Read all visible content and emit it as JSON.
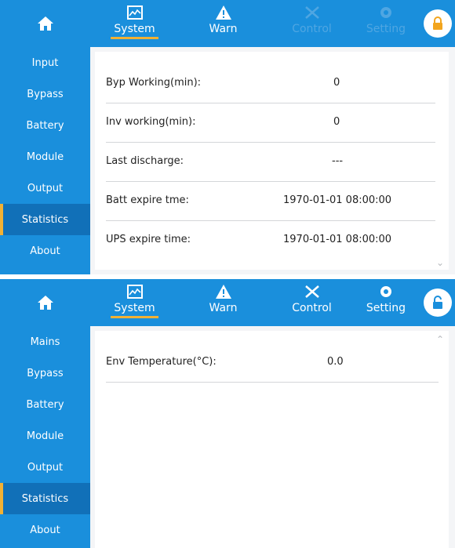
{
  "colors": {
    "bar": "#1a8fdc",
    "accent": "#f2b134",
    "selected": "#1170b8"
  },
  "panel1": {
    "tabs": [
      {
        "label": "System",
        "icon": "chart-icon",
        "state": "active"
      },
      {
        "label": "Warn",
        "icon": "warning-icon",
        "state": "enabled"
      },
      {
        "label": "Control",
        "icon": "tools-icon",
        "state": "disabled"
      },
      {
        "label": "Setting",
        "icon": "gear-icon",
        "state": "disabled"
      }
    ],
    "lock_icon": "lock-closed-icon",
    "sidebar": [
      "Input",
      "Bypass",
      "Battery",
      "Module",
      "Output",
      "Statistics",
      "About"
    ],
    "selected": "Statistics",
    "rows": [
      {
        "label": "Byp Working(min):",
        "value": "0"
      },
      {
        "label": "Inv working(min):",
        "value": "0"
      },
      {
        "label": "Last discharge:",
        "value": "---"
      },
      {
        "label": "Batt expire tme:",
        "value": "1970-01-01 08:00:00"
      },
      {
        "label": "UPS expire time:",
        "value": "1970-01-01 08:00:00"
      }
    ],
    "scroll_icon": "chevron-down-icon"
  },
  "panel2": {
    "tabs": [
      {
        "label": "System",
        "icon": "chart-icon",
        "state": "active"
      },
      {
        "label": "Warn",
        "icon": "warning-icon",
        "state": "enabled"
      },
      {
        "label": "Control",
        "icon": "tools-icon",
        "state": "enabled"
      },
      {
        "label": "Setting",
        "icon": "gear-icon",
        "state": "enabled"
      }
    ],
    "lock_icon": "lock-open-icon",
    "sidebar": [
      "Mains",
      "Bypass",
      "Battery",
      "Module",
      "Output",
      "Statistics",
      "About"
    ],
    "selected": "Statistics",
    "rows": [
      {
        "label": "Env Temperature(°C):",
        "value": "0.0"
      }
    ],
    "scroll_icon": "chevron-up-icon"
  }
}
